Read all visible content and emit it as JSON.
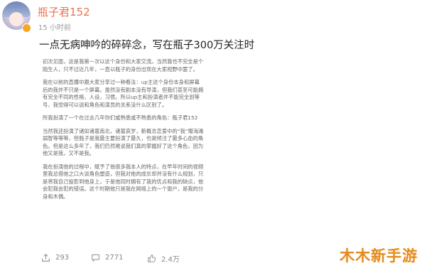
{
  "post": {
    "username": "瓶子君152",
    "time": "15 小时前",
    "title": "一点无病呻吟的碎碎念，写在瓶子300万关注时",
    "paragraphs": [
      "初次见面，这是我第一次以这个身份和大家交流。当然我也不完全是个陌生人，只不过近几年，一直以瓶子的身份出现在大家视野中罢了。",
      "我在以前的直播中跟大家分享过一种看法：up主这个身份本身和屏幕后的我并不只是一个屏幕。虽然没有剧本没有导演，但我们甚至可能拥有完全不同的性格，人设，习惯。所以up主和扮演者并不能完全划等号，我觉得可以说和角色和演员的关系没什么区别了。",
      "所我扮演了一个在过去几年你们或熟悉或不熟悉的角色：瓶子君152",
      "当然我还扮演了诸如诸葛南北，诸葛哀岁，新概念恋爱中的“我”赠海滩弱智等等等，但瓶子是我最主要扮演了最久，也是倾注了最多心血的角色。但是这么多年了，我们仍然难说我们真的掌握好了这个角色，因为他又是我，又不是我。",
      "我在扮演他的过程中，赋予了他很多我本人的特点，在早年时间的视频里我总借他之口大谈角色塑造，但我对他的成长却并没有什么规划，只是将我自己投影到他身上，于是他同时拥有了我的优点和我的缺点，他会犯我会犯的错误。这个时期他只是我在网络上的一个窗户，是我的分身和木偶。"
    ]
  },
  "actions": {
    "share_count": "293",
    "comment_count": "2771",
    "like_count": "2.4万"
  },
  "watermark": "木木新手游",
  "colors": {
    "username": "#eb7350",
    "watermark": "#e58a1f"
  },
  "icons": [
    "share-icon",
    "comment-icon",
    "like-icon"
  ]
}
